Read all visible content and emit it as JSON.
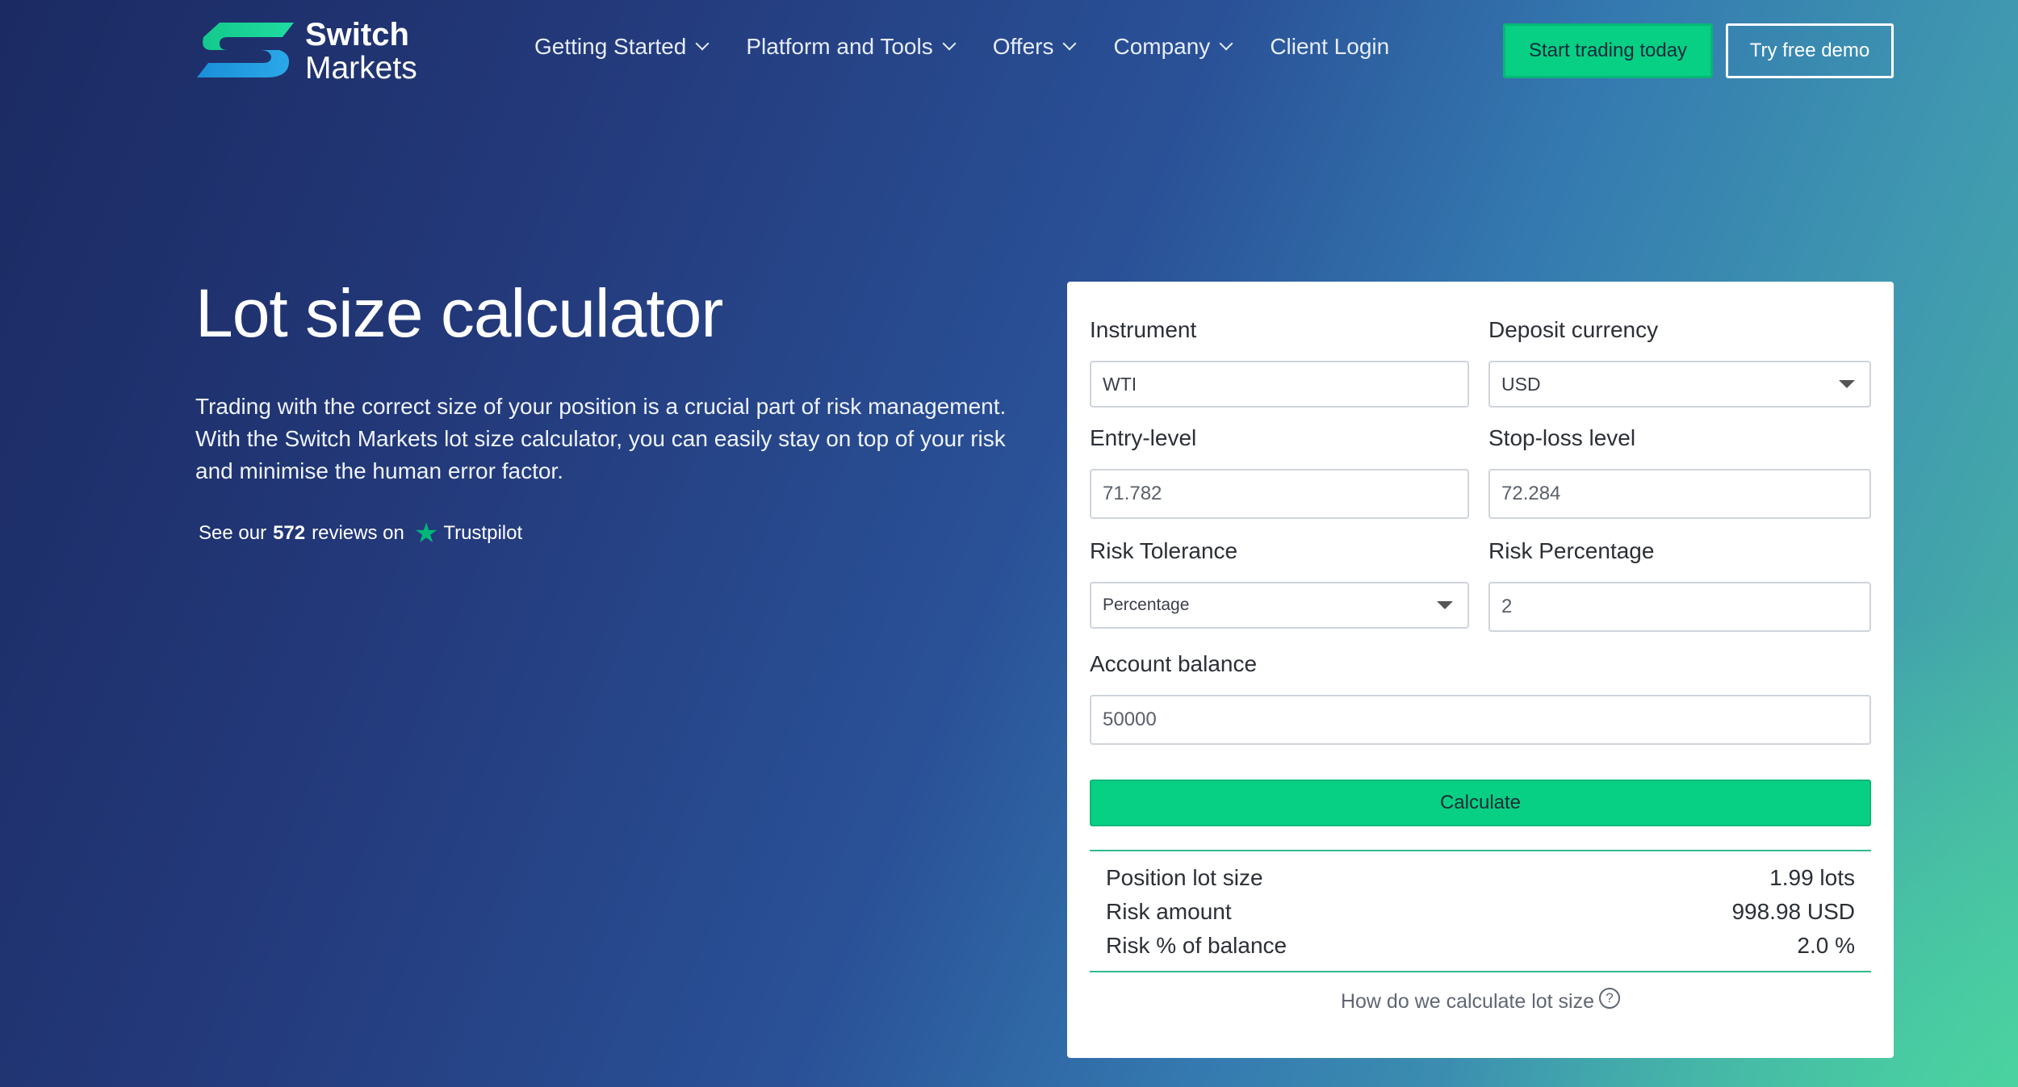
{
  "brand": {
    "line1": "Switch",
    "line2": "Markets"
  },
  "nav": {
    "items": [
      {
        "label": "Getting Started",
        "has_dropdown": true
      },
      {
        "label": "Platform and Tools",
        "has_dropdown": true
      },
      {
        "label": "Offers",
        "has_dropdown": true
      },
      {
        "label": "Company",
        "has_dropdown": true
      },
      {
        "label": "Client Login",
        "has_dropdown": false
      }
    ],
    "cta_primary": "Start trading today",
    "cta_secondary": "Try free demo"
  },
  "hero": {
    "title": "Lot size calculator",
    "description": "Trading with the correct size of your position is a crucial part of risk management. With the Switch Markets lot size calculator, you can easily stay on top of your risk and minimise the human error factor.",
    "trust_prefix": "See our",
    "trust_count": "572",
    "trust_suffix": "reviews on",
    "trust_brand": "Trustpilot"
  },
  "calculator": {
    "instrument": {
      "label": "Instrument",
      "value": "WTI"
    },
    "deposit_currency": {
      "label": "Deposit currency",
      "value": "USD"
    },
    "entry_level": {
      "label": "Entry-level",
      "value": "71.782"
    },
    "stop_loss": {
      "label": "Stop-loss level",
      "value": "72.284"
    },
    "risk_tolerance": {
      "label": "Risk Tolerance",
      "value": "Percentage"
    },
    "risk_percentage": {
      "label": "Risk Percentage",
      "value": "2"
    },
    "account_balance": {
      "label": "Account balance",
      "value": "50000"
    },
    "calculate_label": "Calculate",
    "results": [
      {
        "label": "Position lot size",
        "value": "1.99 lots"
      },
      {
        "label": "Risk amount",
        "value": "998.98 USD"
      },
      {
        "label": "Risk % of balance",
        "value": "2.0 %"
      }
    ],
    "help_link": "How do we calculate lot size",
    "help_icon": "question-circle-icon"
  },
  "colors": {
    "accent": "#07cf84",
    "bg_dark": "#1b2a62",
    "bg_light": "#49b9a2",
    "trustpilot_star": "#00b67a"
  }
}
